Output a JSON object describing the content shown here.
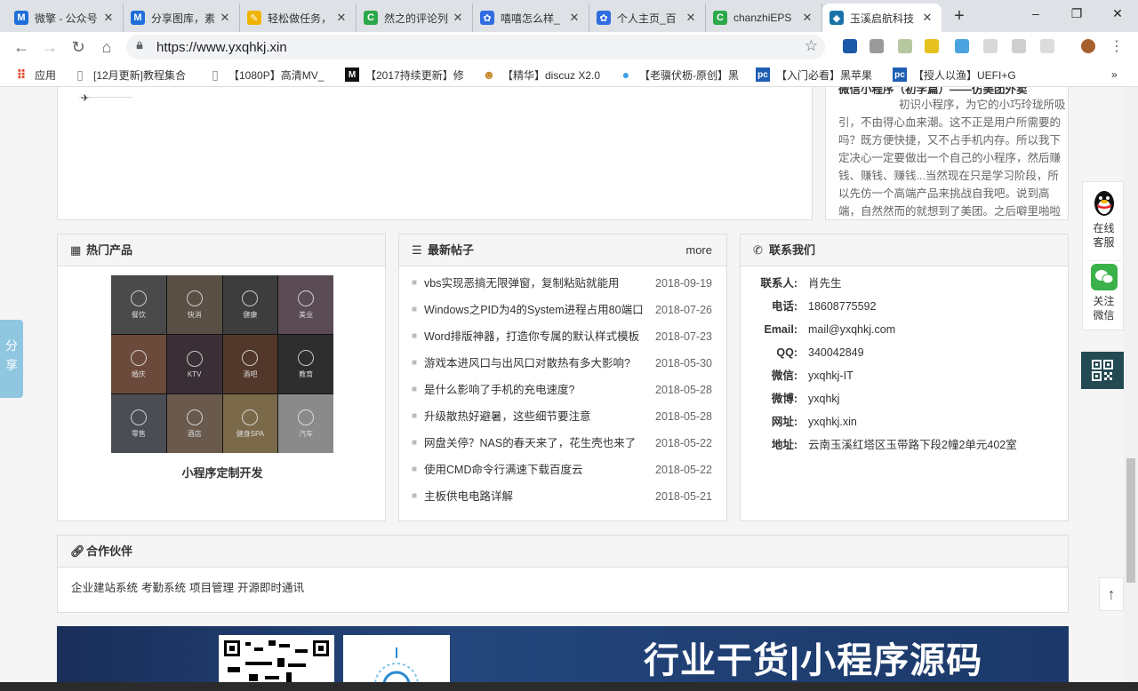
{
  "browser": {
    "tabs": [
      {
        "title": "微擎 - 公众号",
        "icon": "M"
      },
      {
        "title": "分享图库，素",
        "icon": "M"
      },
      {
        "title": "轻松做任务，",
        "icon": "✎"
      },
      {
        "title": "然之的评论列",
        "icon": "C"
      },
      {
        "title": "嘻嘻怎么样_",
        "icon": "✿"
      },
      {
        "title": "个人主页_百",
        "icon": "✿"
      },
      {
        "title": "chanzhiEPS",
        "icon": "C"
      },
      {
        "title": "玉溪启航科技",
        "icon": "◆"
      }
    ],
    "new_tab": "+",
    "url": "https://www.yxqhkj.xin",
    "window_controls": {
      "minimize": "–",
      "restore": "❐",
      "close": "✕"
    },
    "bookmarks": [
      {
        "label": "应用",
        "icon": "apps-icon"
      },
      {
        "label": "[12月更新]教程集合",
        "icon": "page-icon"
      },
      {
        "label": "【1080P】高清MV_",
        "icon": "page-icon"
      },
      {
        "label": "【2017持续更新】修",
        "icon": "m-icon"
      },
      {
        "label": "【精华】discuz X2.0",
        "icon": "mascot-icon"
      },
      {
        "label": "【老骥伏枥-原创】黑",
        "icon": "chat-icon"
      },
      {
        "label": "【入门必看】黑苹果",
        "icon": "pc-icon"
      },
      {
        "label": "【授人以渔】UEFI+G",
        "icon": "pc-icon"
      }
    ],
    "more_bookmarks": "»"
  },
  "page": {
    "top_article": {
      "title": "微信小程序（初学篇）——仿美团外卖",
      "excerpt": "初识小程序，为它的小巧玲珑所吸引，不由得心血来潮。这不正是用户所需要的吗？既方便快捷，又不占手机内存。所以我下定决心一定要做出一个自己的小程序，然后赚钱、赚钱、赚钱...当然现在只是学习阶段，所以先仿一个高端产品来挑战自我吧。说到高端，自然然而的就想到了美团。之后噼里啪啦一顿忙乎，终于做出了一点样子来，希望能为"
    },
    "hot_products": {
      "heading": "热门产品",
      "grid_labels": [
        "餐饮",
        "快消",
        "健康",
        "美业",
        "婚庆",
        "KTV",
        "酒吧",
        "教育",
        "零售",
        "酒店",
        "健身SPA",
        "汽车"
      ],
      "product_name": "小程序定制开发"
    },
    "latest_posts": {
      "heading": "最新帖子",
      "more": "more",
      "items": [
        {
          "title": "vbs实现恶搞无限弹窗，复制粘贴就能用",
          "date": "2018-09-19"
        },
        {
          "title": "Windows之PID为4的System进程占用80端口",
          "date": "2018-07-26"
        },
        {
          "title": "Word排版神器，打造你专属的默认样式模板",
          "date": "2018-07-23"
        },
        {
          "title": "游戏本进风口与出风口对散热有多大影响?",
          "date": "2018-05-30"
        },
        {
          "title": "是什么影响了手机的充电速度?",
          "date": "2018-05-28"
        },
        {
          "title": "升级散热好避暑，这些细节要注意",
          "date": "2018-05-28"
        },
        {
          "title": "网盘关停？NAS的春天来了，花生壳也来了",
          "date": "2018-05-22"
        },
        {
          "title": "使用CMD命令行满速下载百度云",
          "date": "2018-05-22"
        },
        {
          "title": "主板供电电路详解",
          "date": "2018-05-21"
        }
      ]
    },
    "contact": {
      "heading": "联系我们",
      "rows": [
        {
          "label": "联系人:",
          "value": "肖先生"
        },
        {
          "label": "电话:",
          "value": "18608775592"
        },
        {
          "label": "Email:",
          "value": "mail@yxqhkj.com"
        },
        {
          "label": "QQ:",
          "value": "340042849"
        },
        {
          "label": "微信:",
          "value": "yxqhkj-IT"
        },
        {
          "label": "微博:",
          "value": "yxqhkj"
        },
        {
          "label": "网址:",
          "value": "yxqhkj.xin"
        },
        {
          "label": "地址:",
          "value": "云南玉溪红塔区玉带路下段2幢2单元402室"
        }
      ]
    },
    "partners": {
      "heading": "合作伙伴",
      "links": [
        "企业建站系统",
        "考勤系统",
        "项目管理",
        "开源即时通讯"
      ]
    },
    "banner": {
      "text": "行业干货|小程序源码"
    },
    "share_tab": "分享",
    "float_service": {
      "online": "在线客服",
      "wechat": "关注微信"
    },
    "back_to_top": "↑"
  },
  "colors": {
    "accent": "#1a73e8",
    "dark_teal": "#234a53",
    "share_tab": "#8fc6e0",
    "banner": "#1e3a6e"
  }
}
